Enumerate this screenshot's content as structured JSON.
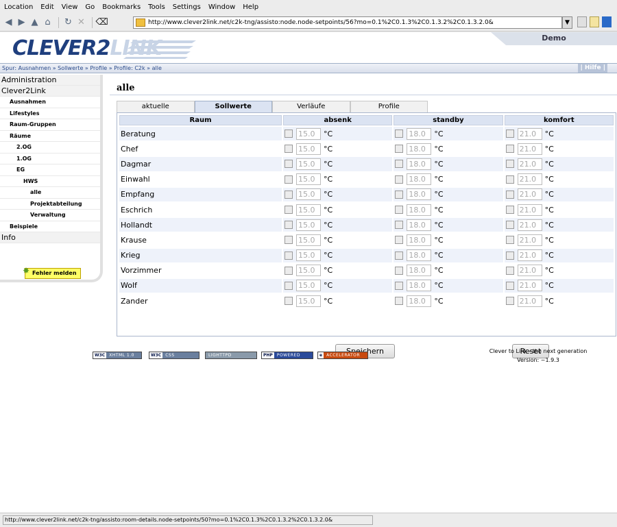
{
  "menubar": [
    "Location",
    "Edit",
    "View",
    "Go",
    "Bookmarks",
    "Tools",
    "Settings",
    "Window",
    "Help"
  ],
  "url": "http://www.clever2link.net/c2k-tng/assisto:node.node-setpoints/56?mo=0.1%2C0.1.3%2C0.1.3.2%2C0.1.3.2.0&",
  "logo": {
    "part1": "CLEVER2",
    "part2": "LINK"
  },
  "demo_tab": "Demo",
  "breadcrumb": "Spur: Ausnahmen » Sollwerte » Profile » Profile: C2k » alle",
  "hilfe": "| Hilfe |",
  "sidebar": [
    {
      "label": "Administration",
      "level": 0
    },
    {
      "label": "Clever2Link",
      "level": 0
    },
    {
      "label": "Ausnahmen",
      "level": 1
    },
    {
      "label": "Lifestyles",
      "level": 1
    },
    {
      "label": "Raum-Gruppen",
      "level": 1
    },
    {
      "label": "Räume",
      "level": 1
    },
    {
      "label": "2.OG",
      "level": 2
    },
    {
      "label": "1.OG",
      "level": 2
    },
    {
      "label": "EG",
      "level": 2
    },
    {
      "label": "HWS",
      "level": 3
    },
    {
      "label": "alle",
      "level": 4
    },
    {
      "label": "Projektabteilung",
      "level": 4
    },
    {
      "label": "Verwaltung",
      "level": 4
    },
    {
      "label": "Beispiele",
      "level": 1
    },
    {
      "label": "Info",
      "level": 0
    }
  ],
  "fehler_button": "Fehler melden",
  "title": "alle",
  "tabs": [
    {
      "label": "aktuelle",
      "active": false
    },
    {
      "label": "Sollwerte",
      "active": true
    },
    {
      "label": "Verläufe",
      "active": false
    },
    {
      "label": "Profile",
      "active": false
    }
  ],
  "columns": [
    "Raum",
    "absenk",
    "standby",
    "komfort"
  ],
  "unit": "°C",
  "rows": [
    {
      "name": "Beratung",
      "absenk": "15.0",
      "standby": "18.0",
      "komfort": "21.0"
    },
    {
      "name": "Chef",
      "absenk": "15.0",
      "standby": "18.0",
      "komfort": "21.0"
    },
    {
      "name": "Dagmar",
      "absenk": "15.0",
      "standby": "18.0",
      "komfort": "21.0"
    },
    {
      "name": "Einwahl",
      "absenk": "15.0",
      "standby": "18.0",
      "komfort": "21.0"
    },
    {
      "name": "Empfang",
      "absenk": "15.0",
      "standby": "18.0",
      "komfort": "21.0"
    },
    {
      "name": "Eschrich",
      "absenk": "15.0",
      "standby": "18.0",
      "komfort": "21.0"
    },
    {
      "name": "Hollandt",
      "absenk": "15.0",
      "standby": "18.0",
      "komfort": "21.0"
    },
    {
      "name": "Krause",
      "absenk": "15.0",
      "standby": "18.0",
      "komfort": "21.0"
    },
    {
      "name": "Krieg",
      "absenk": "15.0",
      "standby": "18.0",
      "komfort": "21.0"
    },
    {
      "name": "Vorzimmer",
      "absenk": "15.0",
      "standby": "18.0",
      "komfort": "21.0"
    },
    {
      "name": "Wolf",
      "absenk": "15.0",
      "standby": "18.0",
      "komfort": "21.0"
    },
    {
      "name": "Zander",
      "absenk": "15.0",
      "standby": "18.0",
      "komfort": "21.0"
    }
  ],
  "buttons": {
    "save": "Speichern",
    "reset": "Reset"
  },
  "badges": [
    {
      "k": "W3C",
      "v": "XHTML 1.0"
    },
    {
      "k": "W3C",
      "v": "CSS"
    },
    {
      "k": "",
      "v": "LIGHTTPD"
    },
    {
      "k": "PHP",
      "v": "POWERED"
    },
    {
      "k": "e",
      "v": "ACCELERATOR"
    }
  ],
  "footer": {
    "line1": "Clever to Link - the next generation",
    "line2": "Version: ~1.9.3"
  },
  "status_url": "http://www.clever2link.net/c2k-tng/assisto:room-details.node-setpoints/50?mo=0.1%2C0.1.3%2C0.1.3.2%2C0.1.3.2.0&"
}
